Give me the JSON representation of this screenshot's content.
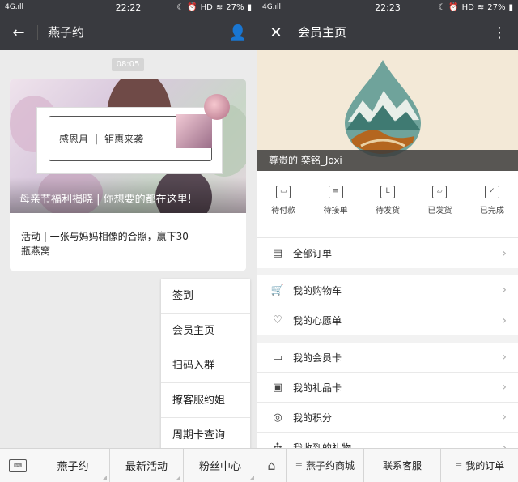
{
  "left": {
    "status": {
      "signal": "4G.ıll",
      "time": "22:22",
      "battery": "27%",
      "hd": "HD"
    },
    "nav": {
      "title": "燕子约"
    },
    "time_chip": "08:05",
    "card": {
      "inner_text_a": "感恩月",
      "inner_text_b": "钜惠来袭",
      "banner_caption": "母亲节福利揭晓 | 你想要的都在这里!",
      "body": "活动 | 一张与妈妈相像的合照，赢下30瓶燕窝"
    },
    "popup": [
      "签到",
      "会员主页",
      "扫码入群",
      "撩客服约姐",
      "周期卡查询"
    ],
    "tabs": [
      "燕子约",
      "最新活动",
      "粉丝中心"
    ]
  },
  "right": {
    "status": {
      "signal": "4G.ıll",
      "time": "22:23",
      "battery": "27%",
      "hd": "HD"
    },
    "nav": {
      "title": "会员主页"
    },
    "hero_caption": "尊贵的 奕铭_Joxi",
    "orders": [
      {
        "label": "待付款",
        "icon": "wallet-icon"
      },
      {
        "label": "待接单",
        "icon": "list-icon"
      },
      {
        "label": "待发货",
        "icon": "box-icon"
      },
      {
        "label": "已发货",
        "icon": "truck-icon"
      },
      {
        "label": "已完成",
        "icon": "check-icon"
      }
    ],
    "groups": [
      [
        {
          "label": "全部订单",
          "icon": "document-icon"
        }
      ],
      [
        {
          "label": "我的购物车",
          "icon": "cart-icon"
        },
        {
          "label": "我的心愿单",
          "icon": "heart-icon"
        }
      ],
      [
        {
          "label": "我的会员卡",
          "icon": "card-icon"
        },
        {
          "label": "我的礼品卡",
          "icon": "gift-card-icon"
        },
        {
          "label": "我的积分",
          "icon": "coins-icon"
        },
        {
          "label": "我收到的礼物",
          "icon": "gift-icon"
        }
      ]
    ],
    "tabs": [
      "燕子约商城",
      "联系客服",
      "我的订单"
    ]
  }
}
